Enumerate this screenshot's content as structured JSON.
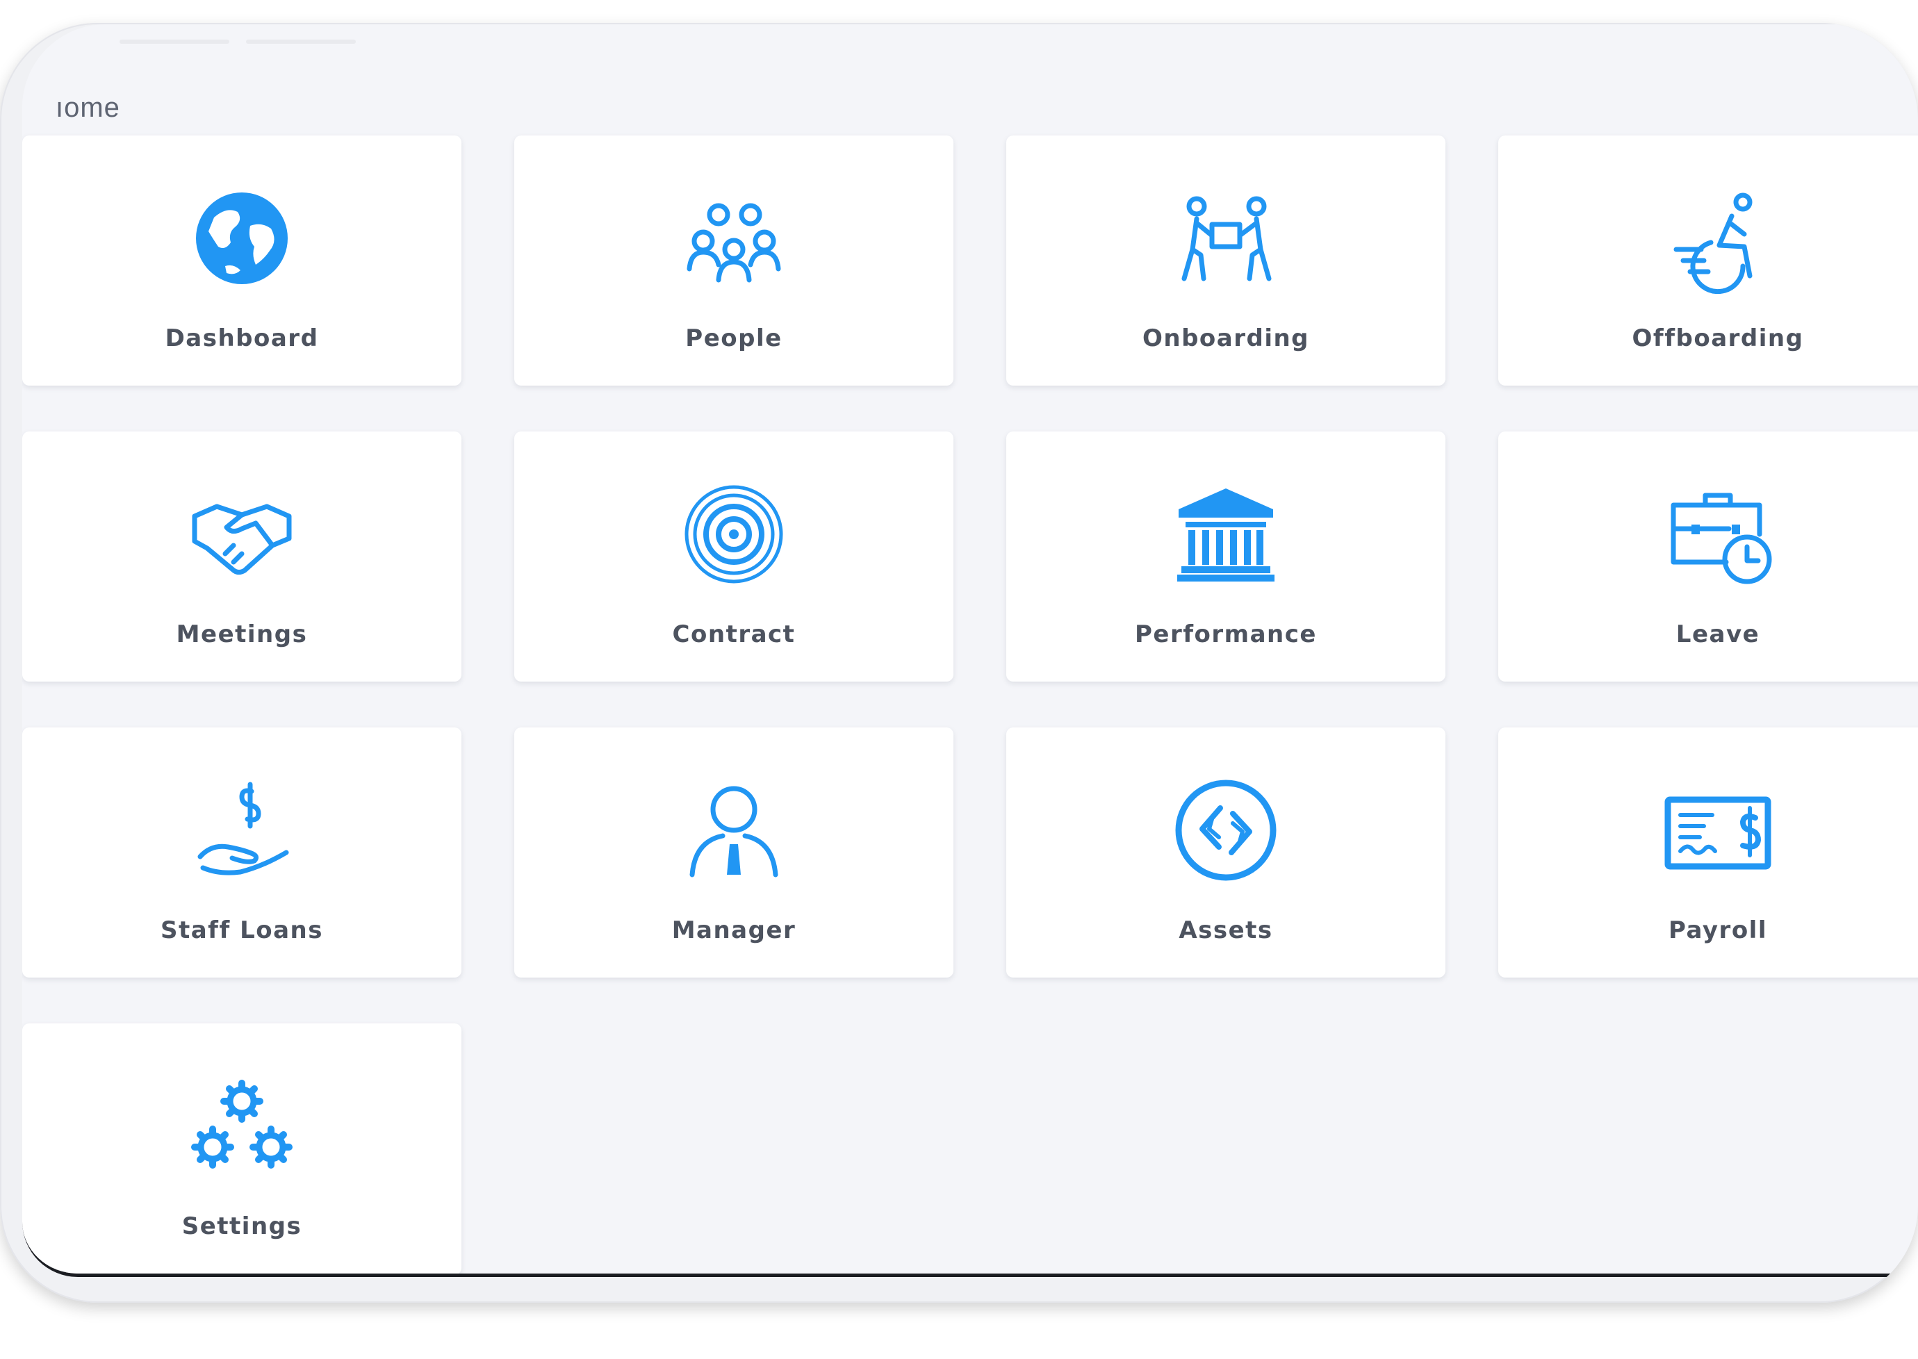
{
  "breadcrumb": {
    "text": "ıome"
  },
  "accent_color": "#2196f3",
  "tiles": [
    {
      "label": "Dashboard",
      "icon": "globe-icon"
    },
    {
      "label": "People",
      "icon": "people-group-icon"
    },
    {
      "label": "Onboarding",
      "icon": "people-carrying-box-icon"
    },
    {
      "label": "Offboarding",
      "icon": "wheelchair-moving-icon"
    },
    {
      "label": "Meetings",
      "icon": "handshake-icon"
    },
    {
      "label": "Contract",
      "icon": "target-icon"
    },
    {
      "label": "Performance",
      "icon": "bank-building-icon"
    },
    {
      "label": "Leave",
      "icon": "briefcase-clock-icon"
    },
    {
      "label": "Staff Loans",
      "icon": "hand-dollar-icon"
    },
    {
      "label": "Manager",
      "icon": "manager-person-icon"
    },
    {
      "label": "Assets",
      "icon": "assets-circle-icon"
    },
    {
      "label": "Payroll",
      "icon": "cheque-dollar-icon"
    },
    {
      "label": "Settings",
      "icon": "gears-icon"
    }
  ]
}
